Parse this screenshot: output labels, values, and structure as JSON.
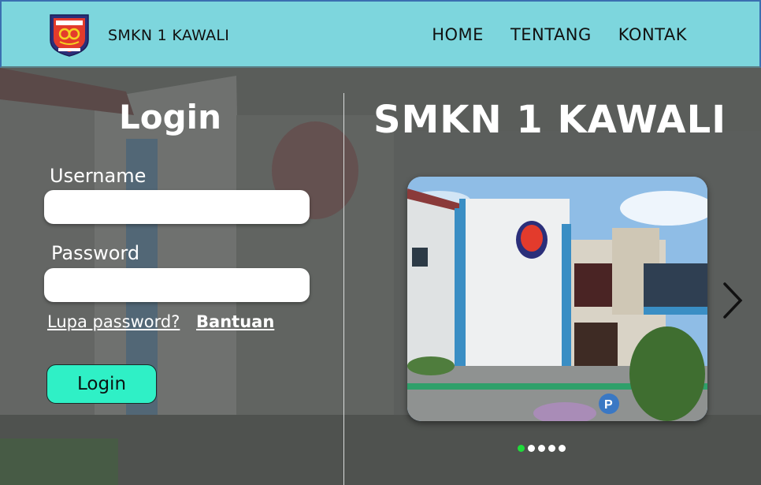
{
  "header": {
    "school_name": "SMKN 1 KAWALI",
    "nav": [
      "HOME",
      "TENTANG",
      "KONTAK"
    ]
  },
  "login": {
    "title": "Login",
    "username_label": "Username",
    "password_label": "Password",
    "username_value": "",
    "password_value": "",
    "forgot_link": "Lupa password?",
    "help_link": "Bantuan",
    "button_label": "Login"
  },
  "hero": {
    "title": "SMKN 1 KAWALI",
    "slides_total": 5,
    "active_slide": 1
  },
  "colors": {
    "header_bg": "#7dd6dd",
    "button_bg": "#2ff0c6",
    "active_dot": "#1fdc3a"
  }
}
